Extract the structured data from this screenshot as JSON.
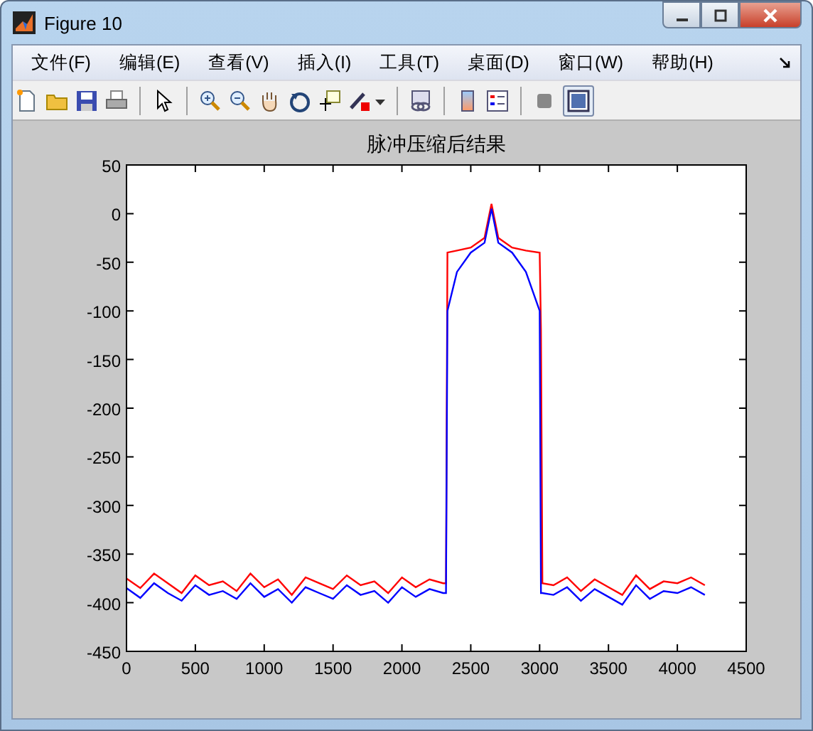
{
  "window": {
    "title": "Figure 10"
  },
  "menu": [
    "文件(F)",
    "编辑(E)",
    "查看(V)",
    "插入(I)",
    "工具(T)",
    "桌面(D)",
    "窗口(W)",
    "帮助(H)"
  ],
  "plot": {
    "chart_data": {
      "type": "line",
      "title": "脉冲压缩后结果",
      "xlim": [
        0,
        4500
      ],
      "ylim": [
        -450,
        50
      ],
      "xticks": [
        0,
        500,
        1000,
        1500,
        2000,
        2500,
        3000,
        3500,
        4000,
        4500
      ],
      "yticks": [
        50,
        0,
        -50,
        -100,
        -150,
        -200,
        -250,
        -300,
        -350,
        -400,
        -450
      ],
      "x": [
        0,
        100,
        200,
        300,
        400,
        500,
        600,
        700,
        800,
        900,
        1000,
        1100,
        1200,
        1300,
        1400,
        1500,
        1600,
        1700,
        1800,
        1900,
        2000,
        2100,
        2200,
        2300,
        2320,
        2330,
        2400,
        2500,
        2600,
        2650,
        2700,
        2800,
        2900,
        3000,
        3010,
        3020,
        3100,
        3200,
        3300,
        3400,
        3500,
        3600,
        3700,
        3800,
        3900,
        4000,
        4100,
        4200
      ],
      "series": [
        {
          "color": "#ff0000",
          "values": [
            -375,
            -385,
            -370,
            -380,
            -390,
            -372,
            -382,
            -378,
            -388,
            -370,
            -384,
            -376,
            -392,
            -374,
            -380,
            -386,
            -372,
            -382,
            -378,
            -390,
            -374,
            -384,
            -376,
            -380,
            -380,
            -40,
            -38,
            -35,
            -25,
            10,
            -25,
            -35,
            -38,
            -40,
            -120,
            -380,
            -382,
            -374,
            -388,
            -376,
            -384,
            -392,
            -372,
            -386,
            -378,
            -380,
            -374,
            -382
          ]
        },
        {
          "color": "#0000ff",
          "values": [
            -385,
            -395,
            -380,
            -390,
            -398,
            -382,
            -392,
            -388,
            -396,
            -380,
            -394,
            -386,
            -400,
            -384,
            -390,
            -396,
            -382,
            -392,
            -388,
            -400,
            -384,
            -394,
            -386,
            -390,
            -390,
            -100,
            -60,
            -40,
            -30,
            5,
            -30,
            -40,
            -60,
            -100,
            -390,
            -390,
            -392,
            -384,
            -398,
            -386,
            -394,
            -402,
            -382,
            -396,
            -388,
            -390,
            -384,
            -392
          ]
        }
      ]
    }
  }
}
